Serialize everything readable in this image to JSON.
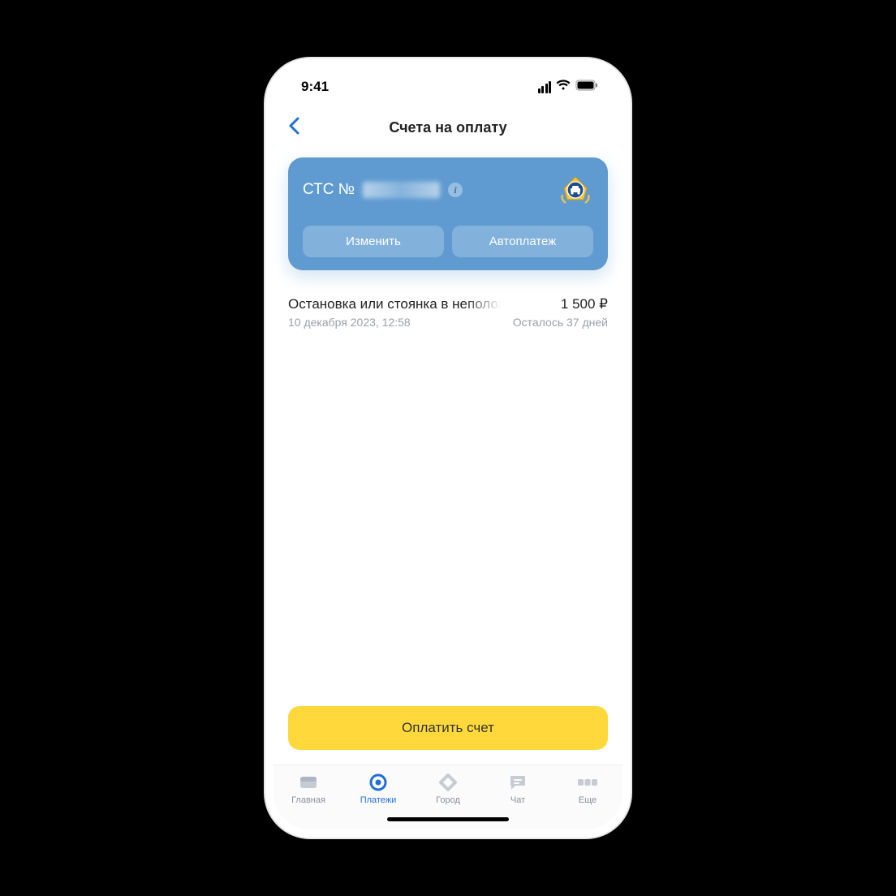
{
  "status": {
    "time": "9:41"
  },
  "header": {
    "title": "Счета на оплату"
  },
  "card": {
    "label_prefix": "СТС №",
    "edit_label": "Изменить",
    "autopay_label": "Автоплатеж"
  },
  "fines": [
    {
      "title": "Остановка или стоянка в неположенном месте",
      "date": "10 декабря 2023, 12:58",
      "amount": "1 500 ₽",
      "remaining": "Осталось 37 дней"
    }
  ],
  "pay_button": "Оплатить счет",
  "tabs": [
    {
      "label": "Главная"
    },
    {
      "label": "Платежи"
    },
    {
      "label": "Город"
    },
    {
      "label": "Чат"
    },
    {
      "label": "Еще"
    }
  ]
}
